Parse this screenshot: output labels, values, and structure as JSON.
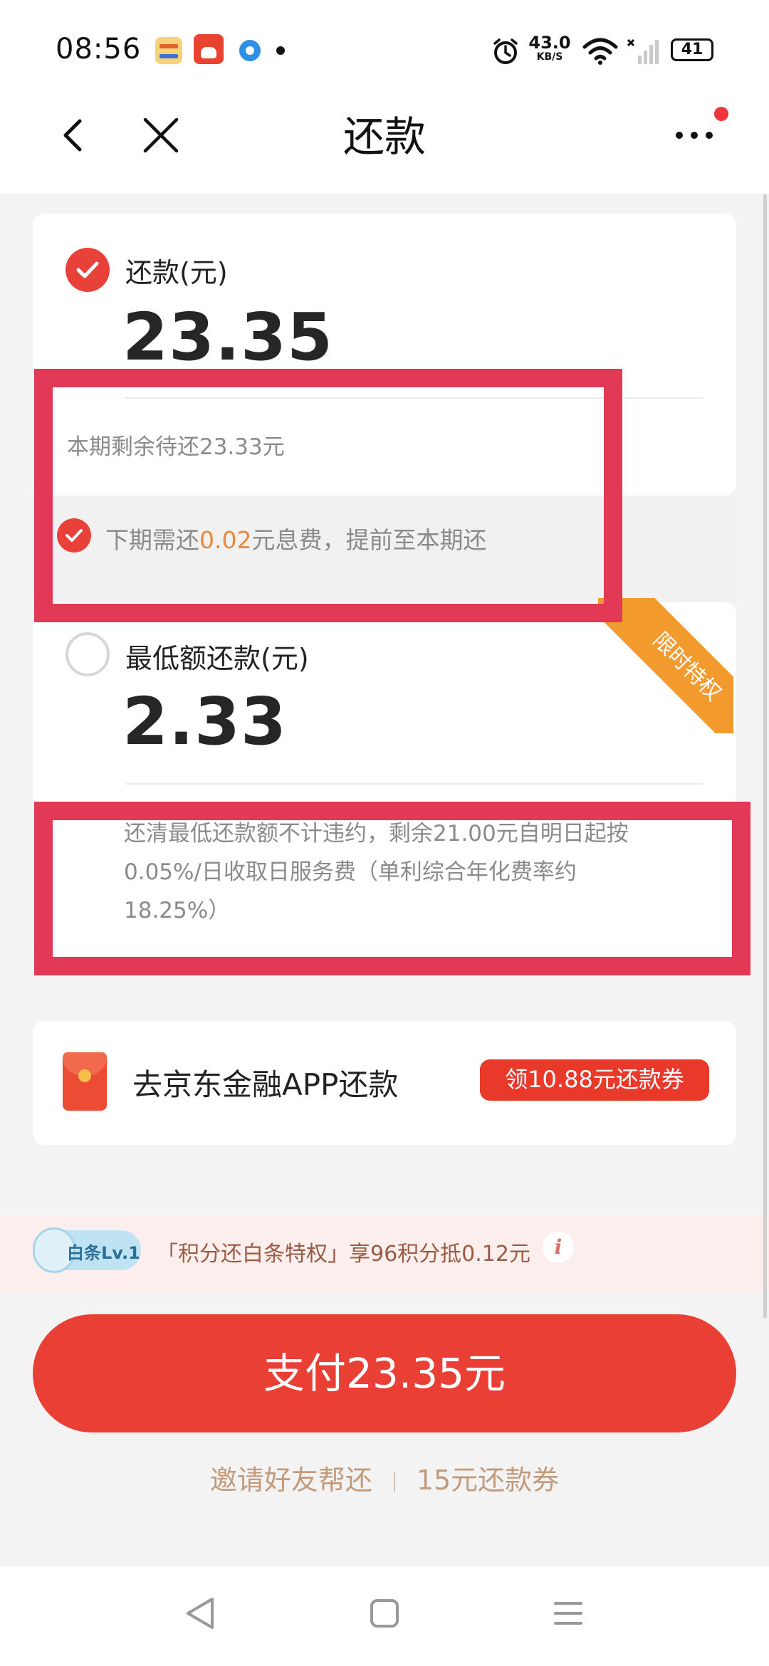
{
  "status_bar": {
    "time": "08:56",
    "net_speed": "43.0",
    "net_speed_unit": "KB/S",
    "battery": "41",
    "icons": [
      "wallet-app-icon",
      "jd-app-icon",
      "blue-app-icon",
      "dot-icon",
      "alarm-icon",
      "wifi-icon",
      "signal-icon",
      "battery-icon"
    ]
  },
  "nav": {
    "title": "还款",
    "back_icon": "chevron-left-icon",
    "close_icon": "close-icon",
    "more_icon": "more-icon"
  },
  "option_full": {
    "label": "还款(元)",
    "amount": "23.35",
    "checked": true,
    "remaining_text": "本期剩余待还23.33元",
    "interest_prefix": "下期需还",
    "interest_amount": "0.02",
    "interest_suffix": "元息费，提前至本期还"
  },
  "option_min": {
    "label": "最低额还款(元)",
    "amount": "2.33",
    "checked": false,
    "badge": "限时特权",
    "note_line1": "还清最低还款额不计违约，剩余21.00元自明日起按",
    "note_line2": "0.05%/日收取日服务费（单利综合年化费率约",
    "note_line3": "18.25%）"
  },
  "jd_app": {
    "label": "去京东金融APP还款",
    "coupon": "领10.88元还款券"
  },
  "points": {
    "level": "白条Lv.1",
    "text": "「积分还白条特权」享96积分抵0.12元",
    "info": "i"
  },
  "pay_button": "支付23.35元",
  "links": {
    "invite": "邀请好友帮还",
    "coupon": "15元还款券"
  },
  "colors": {
    "accent": "#e8413a",
    "annotation_frame": "#e23a56",
    "badge_orange": "#f39a2f",
    "link_tan": "#c39b7b"
  }
}
